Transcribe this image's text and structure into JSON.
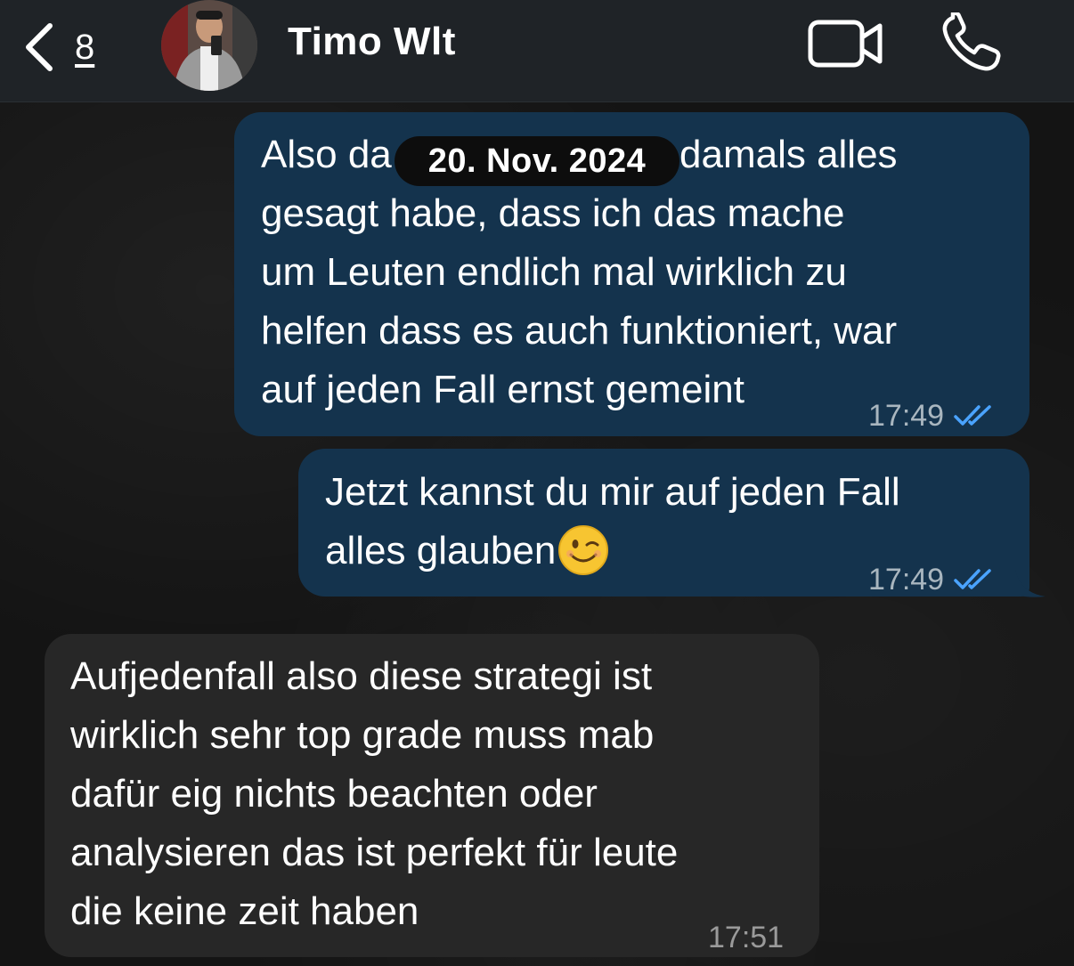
{
  "header": {
    "back_count": "8",
    "contact_name": "Timo Wlt",
    "avatar_icon": "contact-avatar",
    "video_icon": "video-call-icon",
    "call_icon": "phone-icon"
  },
  "date_separator": "20. Nov. 2024",
  "messages": [
    {
      "direction": "outgoing",
      "text": "Also da\ngesagt habe, dass ich das mache\num Leuten endlich mal wirklich zu\nhelfen dass es auch funktioniert, war\nauf jeden Fall ernst gemeint",
      "line1_end": "damals alles",
      "time": "17:49",
      "status": "read"
    },
    {
      "direction": "outgoing",
      "text": "Jetzt kannst du mir auf jeden Fall\nalles glauben",
      "emoji": "winking-face",
      "time": "17:49",
      "status": "read"
    },
    {
      "direction": "incoming",
      "text": "Aufjedenfall also diese strategi ist\nwirklich sehr top grade muss mab\ndafür eig nichts beachten oder\nanalysieren das ist perfekt für leute\ndie keine zeit haben",
      "time": "17:51"
    }
  ],
  "colors": {
    "header_bg": "#1f2327",
    "outgoing_bubble": "#14334d",
    "incoming_bubble": "#272727",
    "read_ticks": "#4aa3ff"
  }
}
